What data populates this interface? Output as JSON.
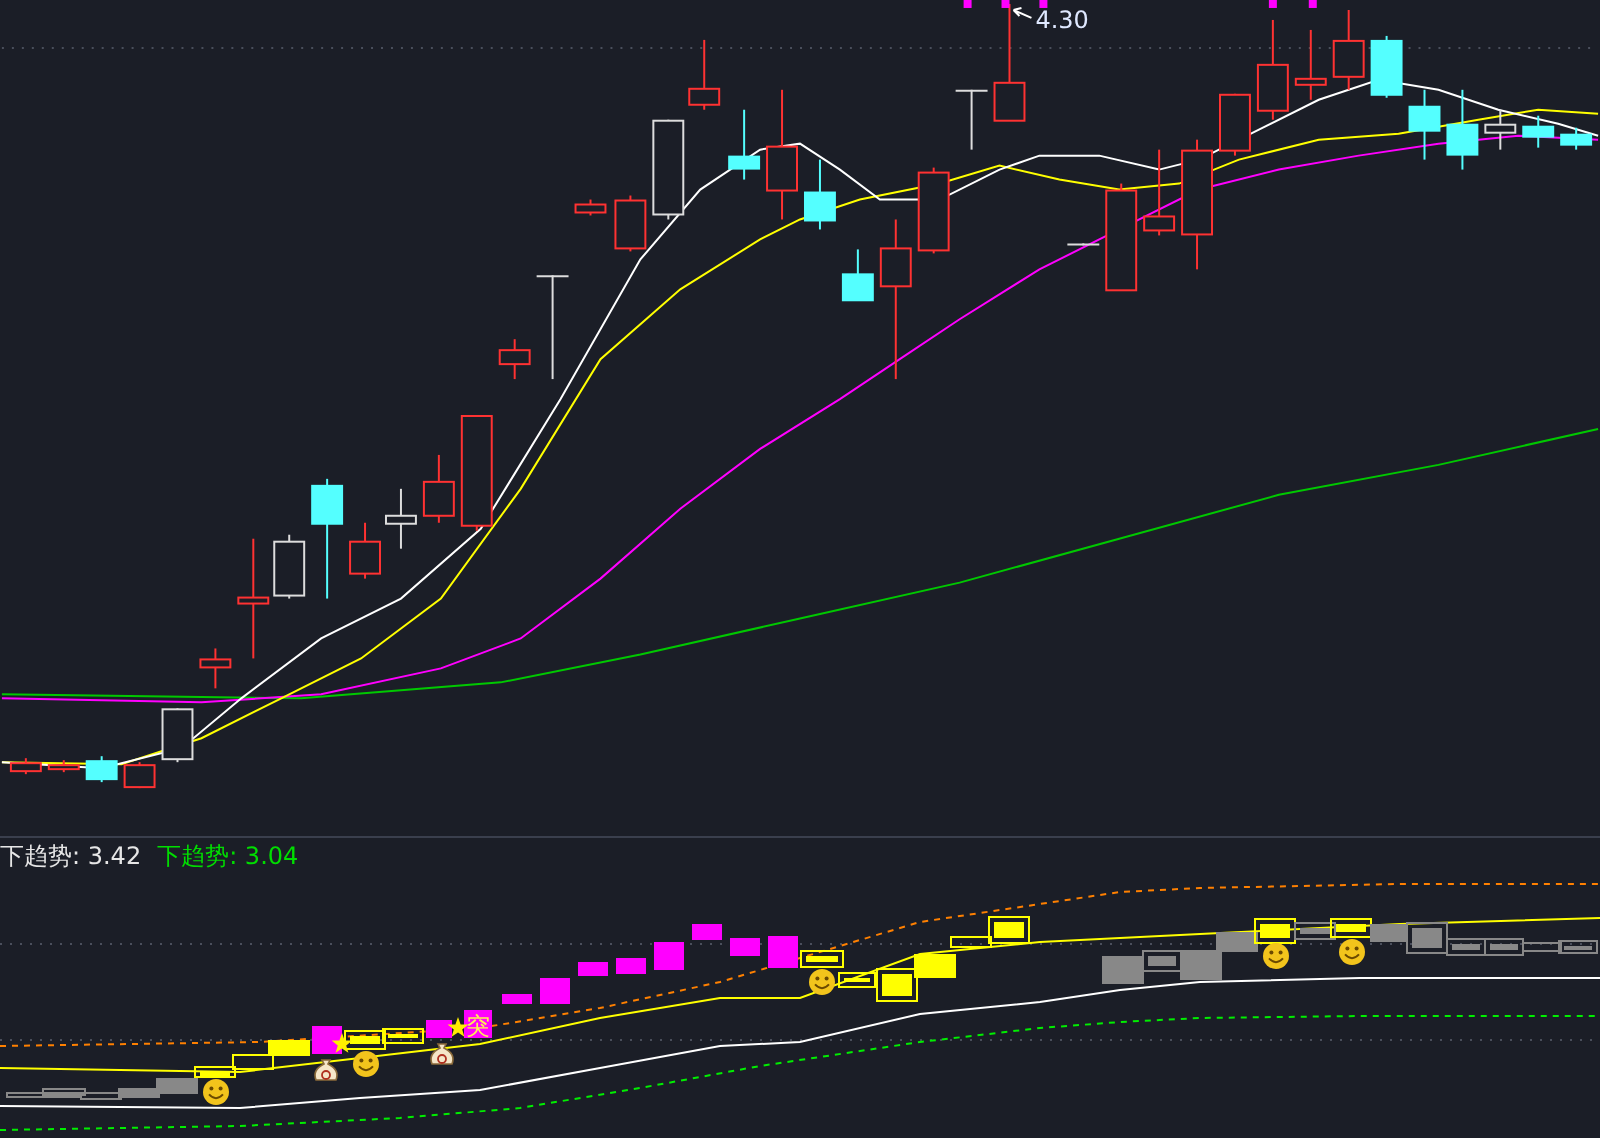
{
  "price_panel": {
    "high_label": "4.30"
  },
  "indicator_panel": {
    "legend": [
      {
        "text": "下趋势: 3.42",
        "color": "#e6e6e6"
      },
      {
        "text": "下趋势: 3.04",
        "color": "#00dd00"
      }
    ],
    "signal_label": "突"
  }
}
